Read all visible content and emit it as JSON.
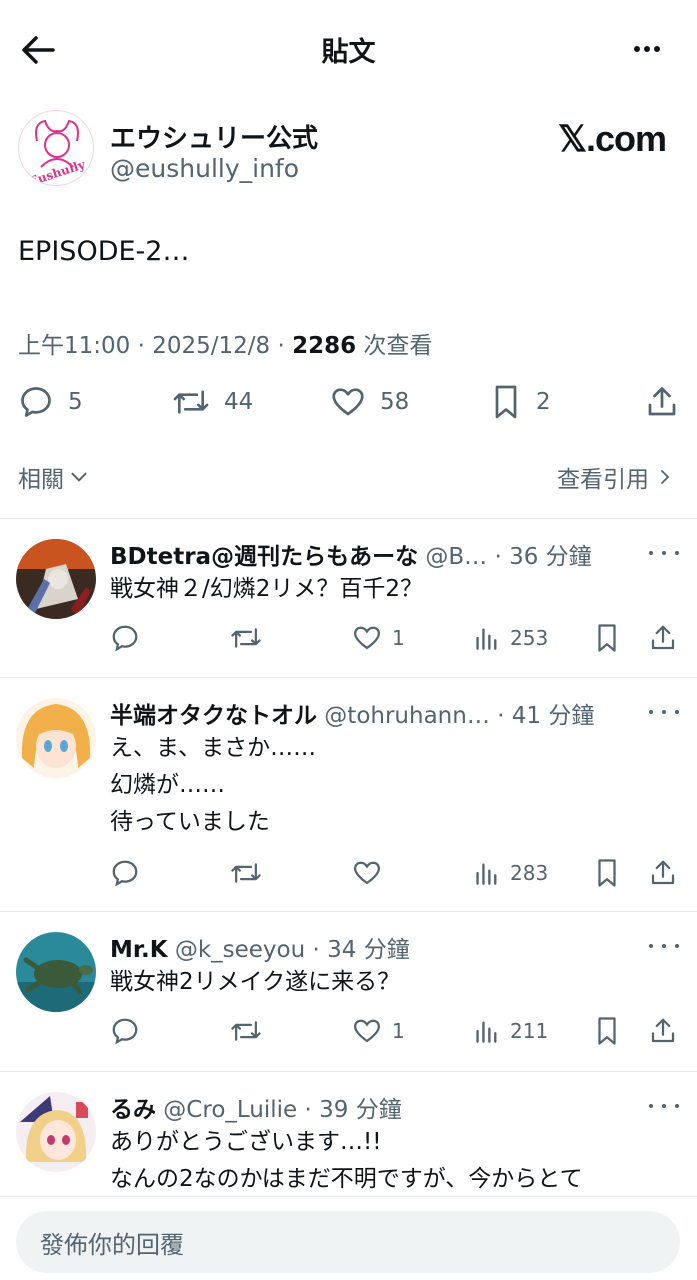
{
  "header": {
    "title": "貼文"
  },
  "post": {
    "author_name": "エウシュリー公式",
    "author_handle": "@eushully_info",
    "brand": "𝕏.com",
    "text": "EPISODE-2…",
    "time": "上午11:00 · 2025/12/8 · ",
    "views_count": "2286",
    "views_label": " 次查看",
    "stats": {
      "replies": "5",
      "reposts": "44",
      "likes": "58",
      "bookmarks": "2"
    },
    "related_label": "相關",
    "quotes_label": "查看引用"
  },
  "replies": [
    {
      "name": "BDtetra@週刊たらもあーな",
      "handle": " @B… · 36 分鐘",
      "lines": [
        "戦女神２/幻燐2リメ？百千2？"
      ],
      "likes": "1",
      "views": "253"
    },
    {
      "name": "半端オタクなトオル",
      "handle": " @tohruhann… · 41 分鐘",
      "lines": [
        "え、ま、まさか……",
        "幻燐が……",
        "待っていました"
      ],
      "likes": "",
      "views": "283"
    },
    {
      "name": "Mr.K",
      "handle": " @k_seeyou · 34 分鐘",
      "lines": [
        "戦女神2リメイク遂に来る？"
      ],
      "likes": "1",
      "views": "211"
    },
    {
      "name": "るみ",
      "handle": " @Cro_Luilie · 39 分鐘",
      "lines": [
        "ありがとうございます…!!",
        "なんの2なのかはまだ不明ですが、今からとて"
      ]
    }
  ],
  "composer": {
    "placeholder": "發佈你的回覆"
  },
  "colors": {
    "text": "#0f1419",
    "secondary": "#536471",
    "divider": "#e6e9eb",
    "input_bg": "#eff3f4"
  }
}
